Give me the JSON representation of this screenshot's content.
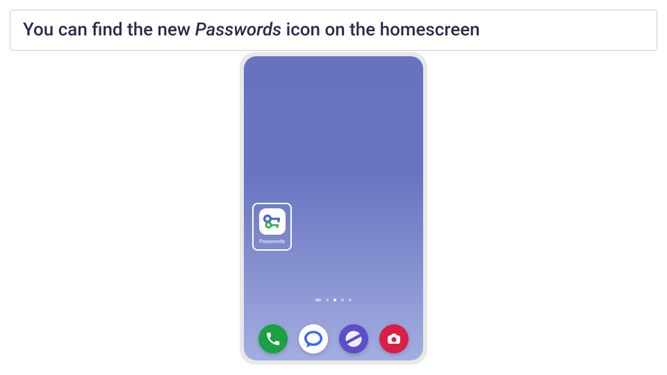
{
  "caption": {
    "prefix": "You can find the new ",
    "highlight": "Passwords",
    "suffix": " icon on the homescreen"
  },
  "homescreen": {
    "highlightedApp": {
      "label": "Passwords",
      "iconName": "passwords-key-icon"
    },
    "pageIndicator": {
      "total": 5,
      "active": 2
    },
    "dock": [
      {
        "name": "phone",
        "iconName": "phone-icon"
      },
      {
        "name": "messages",
        "iconName": "chat-bubble-icon"
      },
      {
        "name": "browser",
        "iconName": "planet-icon"
      },
      {
        "name": "camera",
        "iconName": "camera-icon"
      }
    ]
  },
  "colors": {
    "screenGradientTop": "#6773bf",
    "screenGradientBottom": "#a3aee0",
    "dockPhone": "#1ba142",
    "dockBrowser": "#5b4fc9",
    "dockCamera": "#d91f48",
    "captionText": "#2c2a4a"
  }
}
